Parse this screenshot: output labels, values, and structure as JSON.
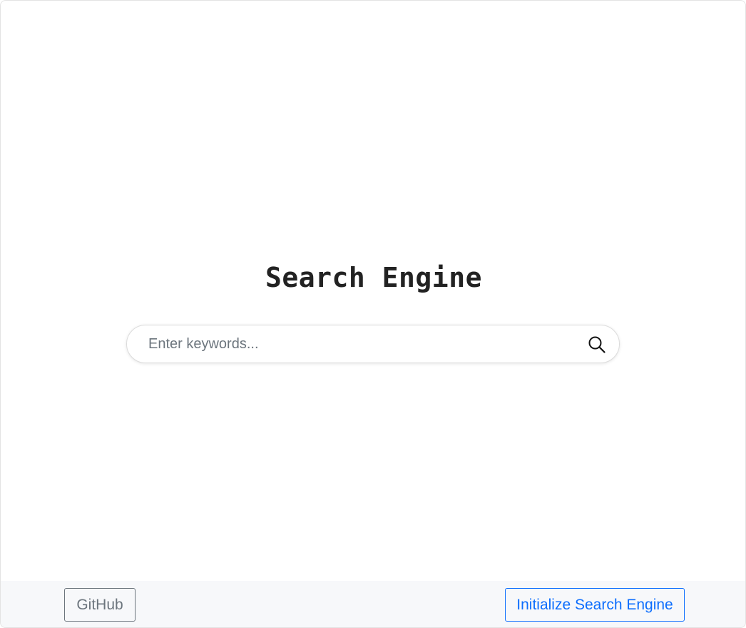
{
  "main": {
    "title": "Search Engine",
    "search": {
      "placeholder": "Enter keywords...",
      "value": "",
      "icon": "search-icon"
    }
  },
  "footer": {
    "github_label": "GitHub",
    "init_label": "Initialize Search Engine"
  },
  "colors": {
    "primary": "#0d6efd",
    "secondary": "#6c757d",
    "footer_background": "#f7f8fa",
    "title_text": "#222222"
  }
}
